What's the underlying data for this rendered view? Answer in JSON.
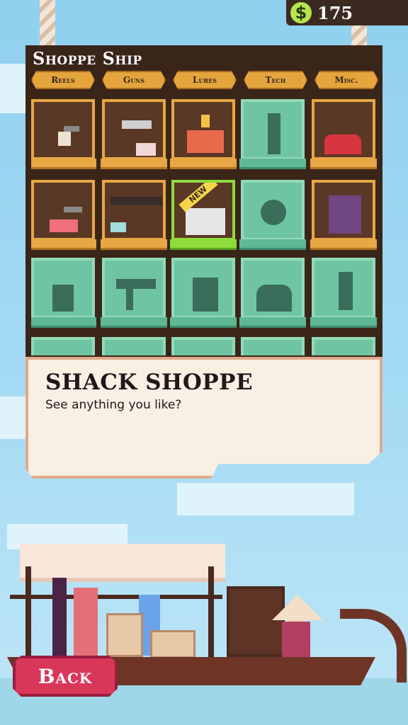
{
  "currency": {
    "symbol": "$",
    "amount": "175",
    "icon": "dollar-coin-icon",
    "color": "#b6e54e"
  },
  "shop": {
    "title": "Shoppe Ship",
    "tabs": [
      {
        "label": "Reels"
      },
      {
        "label": "Guns"
      },
      {
        "label": "Lures"
      },
      {
        "label": "Tech"
      },
      {
        "label": "Misc."
      }
    ],
    "items": [
      {
        "icon": "reel-icon",
        "state": "owned"
      },
      {
        "icon": "revolver-icon",
        "state": "owned"
      },
      {
        "icon": "lure-box-icon",
        "state": "owned"
      },
      {
        "icon": "spring-icon",
        "state": "locked"
      },
      {
        "icon": "red-cap-icon",
        "state": "owned"
      },
      {
        "icon": "reel-icon",
        "state": "owned"
      },
      {
        "icon": "shotgun-icon",
        "state": "owned"
      },
      {
        "icon": "lure-kit-icon",
        "state": "new",
        "badge": "NEW"
      },
      {
        "icon": "gear-icon",
        "state": "locked"
      },
      {
        "icon": "book-icon",
        "state": "owned"
      },
      {
        "icon": "reel-silhouette-icon",
        "state": "locked"
      },
      {
        "icon": "smg-silhouette-icon",
        "state": "locked"
      },
      {
        "icon": "fuel-can-silhouette-icon",
        "state": "locked"
      },
      {
        "icon": "bag-silhouette-icon",
        "state": "locked"
      },
      {
        "icon": "bottle-silhouette-icon",
        "state": "locked"
      }
    ]
  },
  "dialog": {
    "title": "SHACK SHOPPE",
    "text": "See anything you like?"
  },
  "nav": {
    "back_label": "Back"
  }
}
